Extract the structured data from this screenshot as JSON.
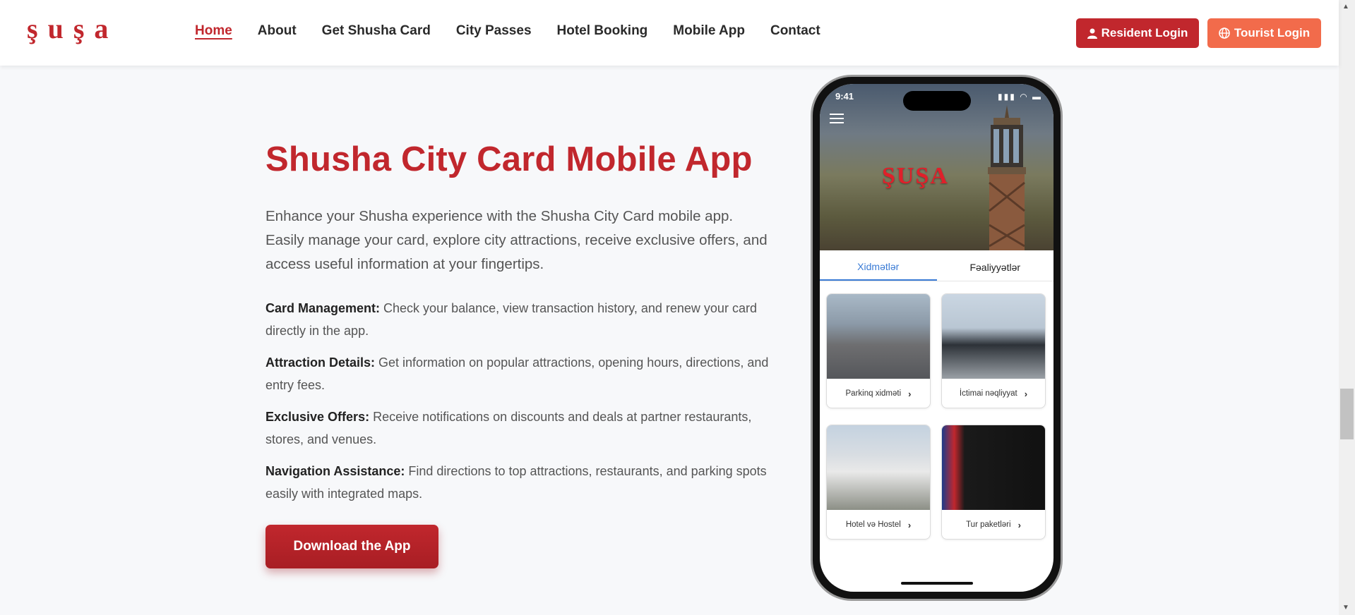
{
  "header": {
    "logo_text": "Şuşa",
    "nav": [
      {
        "label": "Home",
        "active": true
      },
      {
        "label": "About"
      },
      {
        "label": "Get Shusha Card"
      },
      {
        "label": "City Passes"
      },
      {
        "label": "Hotel Booking"
      },
      {
        "label": "Mobile App"
      },
      {
        "label": "Contact"
      }
    ],
    "resident_login": "Resident Login",
    "tourist_login": "Tourist Login"
  },
  "main": {
    "title": "Shusha City Card Mobile App",
    "intro": "Enhance your Shusha experience with the Shusha City Card mobile app. Easily manage your card, explore city attractions, receive exclusive offers, and access useful information at your fingertips.",
    "features": [
      {
        "title": "Card Management:",
        "text": " Check your balance, view transaction history, and renew your card directly in the app."
      },
      {
        "title": "Attraction Details:",
        "text": " Get information on popular attractions, opening hours, directions, and entry fees."
      },
      {
        "title": "Exclusive Offers:",
        "text": " Receive notifications on discounts and deals at partner restaurants, stores, and venues."
      },
      {
        "title": "Navigation Assistance:",
        "text": " Find directions to top attractions, restaurants, and parking spots easily with integrated maps."
      }
    ],
    "download_button": "Download the App"
  },
  "phone": {
    "time": "9:41",
    "logo": "ŞUŞA",
    "tabs": [
      "Xidmətlər",
      "Fəaliyyətlər"
    ],
    "cards": [
      {
        "label": "Parkinq xidməti"
      },
      {
        "label": "İctimai nəqliyyat"
      },
      {
        "label": "Hotel və Hostel"
      },
      {
        "label": "Tur paketləri"
      }
    ]
  },
  "colors": {
    "brand_red": "#c1272d",
    "tourist_orange": "#f26b4b",
    "tab_active_blue": "#3a7bd5"
  }
}
